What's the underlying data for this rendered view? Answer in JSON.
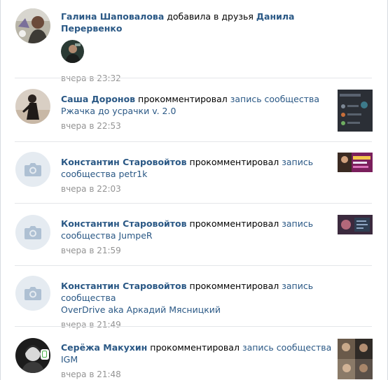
{
  "feed": [
    {
      "author": "Галина Шаповалова",
      "action": "добавила в друзья",
      "target": "Данила Перервенко",
      "time": "вчера в 23:32"
    },
    {
      "author": "Саша Доронов",
      "action": "прокомментировал",
      "link": "запись сообщества",
      "link2": "Ржачка до усрачки v. 2.0",
      "time": "вчера в 22:53"
    },
    {
      "author": "Константин Старовойтов",
      "action": "прокомментировал",
      "link": "запись",
      "link2": "сообщества petr1k",
      "time": "вчера в 22:03"
    },
    {
      "author": "Константин Старовойтов",
      "action": "прокомментировал",
      "link": "запись",
      "link2": "сообщества JumpeR",
      "time": "вчера в 21:59"
    },
    {
      "author": "Константин Старовойтов",
      "action": "прокомментировал",
      "link": "запись сообщества",
      "link2": "OverDrive aka Аркадий Мясницкий",
      "time": "вчера в 21:49"
    },
    {
      "author": "Серёжа Макухин",
      "action": "прокомментировал",
      "link": "запись сообщества IGM",
      "time": "вчера в 21:48"
    }
  ],
  "colors": {
    "link": "#2a5885",
    "time": "#939393",
    "separator": "#e4e6e9",
    "camera_bg": "#e5ebf1",
    "camera_fg": "#aec0d3",
    "online": "#4bb34b"
  }
}
